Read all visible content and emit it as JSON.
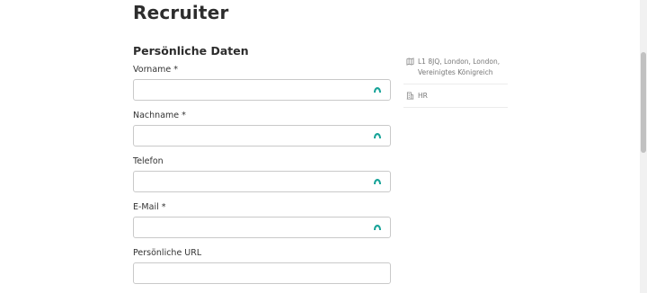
{
  "header": {
    "title": "Recruiter"
  },
  "form": {
    "section_title": "Persönliche Daten",
    "fields": [
      {
        "label": "Vorname *",
        "value": "",
        "autofill_icon": "autofill-icon"
      },
      {
        "label": "Nachname *",
        "value": "",
        "autofill_icon": "autofill-icon"
      },
      {
        "label": "Telefon",
        "value": "",
        "autofill_icon": "autofill-icon"
      },
      {
        "label": "E-Mail *",
        "value": "",
        "autofill_icon": "autofill-icon"
      },
      {
        "label": "Persönliche URL",
        "value": ""
      }
    ]
  },
  "sidebar": {
    "location": {
      "icon": "map-icon",
      "text": "L1 8JQ, London, London, Vereinigtes Königreich"
    },
    "department": {
      "icon": "building-icon",
      "text": "HR"
    }
  },
  "colors": {
    "accent": "#17a398",
    "border": "#c9c9c9",
    "text": "#2d2d2d",
    "muted": "#777777"
  }
}
